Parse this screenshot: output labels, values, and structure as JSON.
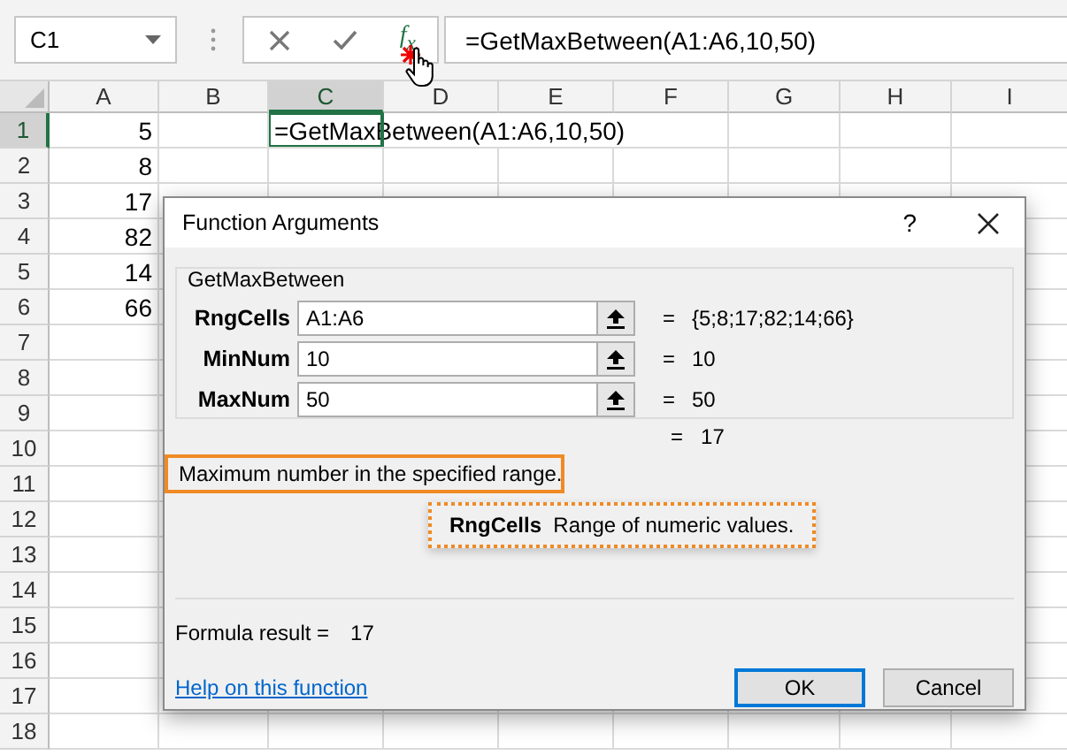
{
  "name_box": {
    "value": "C1"
  },
  "formula_bar": {
    "function_label": "f$_{x}$",
    "formula": "=GetMaxBetween(A1:A6,10,50)"
  },
  "sheet": {
    "columns": [
      {
        "label": "A",
        "selected": false
      },
      {
        "label": "B",
        "selected": false
      },
      {
        "label": "C",
        "selected": true
      },
      {
        "label": "D",
        "selected": false
      },
      {
        "label": "E",
        "selected": false
      },
      {
        "label": "F",
        "selected": false
      },
      {
        "label": "G",
        "selected": false
      },
      {
        "label": "H",
        "selected": false
      },
      {
        "label": "I",
        "selected": false
      }
    ],
    "rows": [
      {
        "label": "1",
        "selected": true,
        "column_a": "5",
        "column_c": "=GetMaxBetween(A1:A6,10,50)"
      },
      {
        "label": "2",
        "selected": false,
        "column_a": "8"
      },
      {
        "label": "3",
        "selected": false,
        "column_a": "17"
      },
      {
        "label": "4",
        "selected": false,
        "column_a": "82"
      },
      {
        "label": "5",
        "selected": false,
        "column_a": "14"
      },
      {
        "label": "6",
        "selected": false,
        "column_a": "66"
      },
      {
        "label": "7",
        "selected": false
      },
      {
        "label": "8",
        "selected": false
      },
      {
        "label": "9",
        "selected": false
      },
      {
        "label": "10",
        "selected": false
      },
      {
        "label": "11",
        "selected": false
      },
      {
        "label": "12",
        "selected": false
      },
      {
        "label": "13",
        "selected": false
      },
      {
        "label": "14",
        "selected": false
      },
      {
        "label": "15",
        "selected": false
      },
      {
        "label": "16",
        "selected": false
      },
      {
        "label": "17",
        "selected": false
      },
      {
        "label": "18",
        "selected": false
      }
    ]
  },
  "dialog": {
    "title": "Function Arguments",
    "help": "?",
    "group_label": "GetMaxBetween",
    "arguments": [
      {
        "name": "RngCells",
        "value": "A1:A6",
        "equals": "=",
        "result": "{5;8;17;82;14;66}"
      },
      {
        "name": "MinNum",
        "value": "10",
        "equals": "=",
        "result": "10"
      },
      {
        "name": "MaxNum",
        "value": "50",
        "equals": "=",
        "result": "50"
      }
    ],
    "function_result": {
      "equals": "=",
      "result": "17"
    },
    "description": "Maximum number in the specified range.",
    "argument_help": "**RngCells**  Range of numeric values.",
    "formula_result_label": "Formula result =",
    "formula_result": "17",
    "help_link": "Help on this function",
    "buttons": [
      {
        "label": "OK",
        "default": true
      },
      {
        "label": "Cancel",
        "default": false
      }
    ]
  }
}
